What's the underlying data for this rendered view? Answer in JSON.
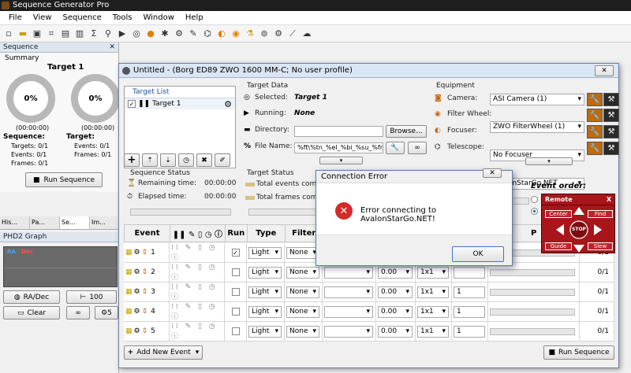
{
  "app": {
    "title": "Sequence Generator Pro"
  },
  "menu": [
    "File",
    "View",
    "Sequence",
    "Tools",
    "Window",
    "Help"
  ],
  "left": {
    "sequence_panel_title": "Sequence",
    "summary_label": "Summary",
    "target1": {
      "name": "Target 1",
      "pct": "0%",
      "time": "(00:00:00)",
      "seq_label": "Sequence:",
      "targets": "Targets: 0/1",
      "events": "Events: 0/1",
      "frames": "Frames: 0/1"
    },
    "target2": {
      "pct": "0%",
      "time": "(00:00:00)",
      "label": "Target:",
      "events": "Events: 0/1",
      "frames": "Frames: 0/1"
    },
    "run_button": "Run Sequence",
    "tabs": [
      "His...",
      "Pa...",
      "Se...",
      "Im..."
    ],
    "phd_title": "PHD2 Graph",
    "graph_ra": "RA",
    "graph_dec": "Dec",
    "radec_button": "RA/Dec",
    "scale_button": "100",
    "clear_button": "Clear",
    "btn5": "5"
  },
  "window": {
    "title": "Untitled - (Borg ED89 ZWO 1600 MM-C; No user profile)",
    "target_list_title": "Target List",
    "target_item": "Target 1",
    "target_data_title": "Target Data",
    "selected_label": "Selected:",
    "selected_value": "Target 1",
    "running_label": "Running:",
    "running_value": "None",
    "directory_label": "Directory:",
    "directory_value": "",
    "browse_button": "Browse...",
    "filename_label": "File Name:",
    "filename_value": "%ft\\%tn_%el_%bi_%su_%fn",
    "equipment_title": "Equipment",
    "camera_label": "Camera:",
    "camera_value": "ASI Camera (1)",
    "filterwheel_label": "Filter Wheel:",
    "filterwheel_value": "ZWO FilterWheel (1)",
    "focuser_label": "Focuser:",
    "focuser_value": "No Focuser",
    "telescope_label": "Telescope:",
    "telescope_value": "AvalonStarGo.NET",
    "seq_status_title": "Sequence Status",
    "remaining_label": "Remaining time:",
    "remaining_value": "00:00:00",
    "elapsed_label": "Elapsed time:",
    "elapsed_value": "00:00:00",
    "target_status_title": "Target Status",
    "total_events": "Total events complete",
    "total_frames": "Total frames complete",
    "event_order": "Event order:",
    "columns": {
      "event": "Event",
      "run": "Run",
      "type": "Type",
      "filter": "Filter",
      "p": "P"
    },
    "rows": [
      {
        "num": "1",
        "run": true,
        "type": "Light",
        "filter": "None",
        "exp": "",
        "bin": "",
        "count": "",
        "progress": "0/1"
      },
      {
        "num": "2",
        "run": false,
        "type": "Light",
        "filter": "None",
        "exp": "0.00",
        "bin": "1x1",
        "count": "",
        "progress": "0/1"
      },
      {
        "num": "3",
        "run": false,
        "type": "Light",
        "filter": "None",
        "exp": "0.00",
        "bin": "1x1",
        "count": "1",
        "progress": "0/1"
      },
      {
        "num": "4",
        "run": false,
        "type": "Light",
        "filter": "None",
        "exp": "0.00",
        "bin": "1x1",
        "count": "1",
        "progress": "0/1"
      },
      {
        "num": "5",
        "run": false,
        "type": "Light",
        "filter": "None",
        "exp": "0.00",
        "bin": "1x1",
        "count": "1",
        "progress": "0/1"
      }
    ],
    "add_event_button": "Add New Event",
    "run_sequence_button": "Run Sequence"
  },
  "dialog": {
    "title": "Connection Error",
    "message": "Error connecting to AvalonStarGo.NET!",
    "ok": "OK"
  },
  "remote": {
    "title": "Remote",
    "close": "X",
    "center": "Center",
    "find": "Find",
    "stop": "STOP",
    "guide": "Guide",
    "slew": "Slew"
  },
  "colors": {
    "titlebar": "#1e1e1e",
    "remote_bg": "#a8151b",
    "error_icon": "#d42a2a",
    "accent_blue": "#1f4fa0",
    "wrench_bg": "#c06a10"
  }
}
